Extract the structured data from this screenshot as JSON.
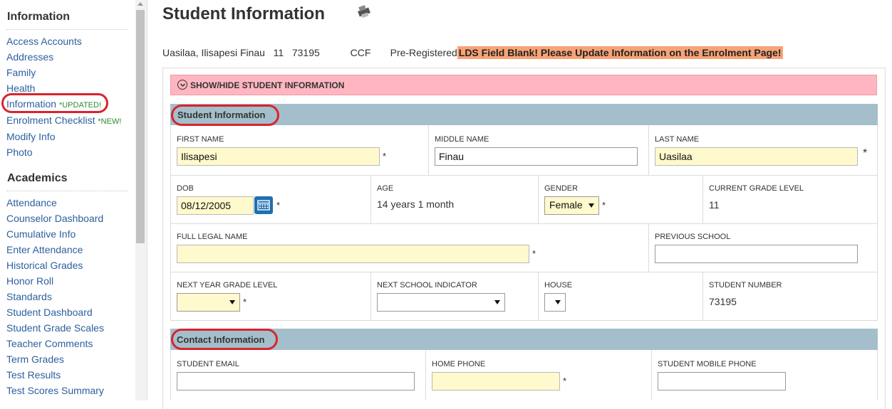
{
  "sidebar": {
    "information_heading": "Information",
    "information_items": [
      {
        "label": "Access Accounts"
      },
      {
        "label": "Addresses"
      },
      {
        "label": "Family"
      },
      {
        "label": "Health"
      },
      {
        "label": "Information",
        "tag": "*UPDATED!"
      },
      {
        "label": "Enrolment Checklist",
        "tag": "*NEW!"
      },
      {
        "label": "Modify Info"
      },
      {
        "label": "Photo"
      }
    ],
    "academics_heading": "Academics",
    "academics_items": [
      {
        "label": "Attendance"
      },
      {
        "label": "Counselor Dashboard"
      },
      {
        "label": "Cumulative Info"
      },
      {
        "label": "Enter Attendance"
      },
      {
        "label": "Historical Grades"
      },
      {
        "label": "Honor Roll"
      },
      {
        "label": "Standards"
      },
      {
        "label": "Student Dashboard"
      },
      {
        "label": "Student Grade Scales"
      },
      {
        "label": "Teacher Comments"
      },
      {
        "label": "Term Grades"
      },
      {
        "label": "Test Results"
      },
      {
        "label": "Test Scores Summary"
      }
    ]
  },
  "main": {
    "title": "Student Information",
    "print_icon": "print-icon",
    "summary": {
      "name": "Uasilaa, Ilisapesi Finau",
      "grade": "11",
      "student_number": "73195",
      "school": "CCF",
      "status": "Pre-Registered",
      "warning": "LDS Field Blank! Please Update Information on the Enrolment Page!"
    },
    "toggle_label": "SHOW/HIDE STUDENT INFORMATION",
    "student_section": {
      "title": "Student Information",
      "first_name_label": "FIRST NAME",
      "first_name_value": "Ilisapesi",
      "middle_name_label": "MIDDLE NAME",
      "middle_name_value": "Finau",
      "last_name_label": "LAST NAME",
      "last_name_value": "Uasilaa",
      "dob_label": "DOB",
      "dob_value": "08/12/2005",
      "age_label": "AGE",
      "age_value": "14 years 1 month",
      "gender_label": "GENDER",
      "gender_value": "Female",
      "grade_level_label": "CURRENT GRADE LEVEL",
      "grade_level_value": "11",
      "legal_name_label": "FULL LEGAL NAME",
      "legal_name_value": "",
      "previous_school_label": "PREVIOUS SCHOOL",
      "previous_school_value": "",
      "next_grade_label": "NEXT YEAR GRADE LEVEL",
      "next_school_label": "NEXT SCHOOL INDICATOR",
      "house_label": "HOUSE",
      "student_number_label": "STUDENT NUMBER",
      "student_number_value": "73195"
    },
    "contact_section": {
      "title": "Contact Information",
      "email_label": "STUDENT EMAIL",
      "email_value": "",
      "home_phone_label": "HOME PHONE",
      "home_phone_value": "",
      "mobile_label": "STUDENT MOBILE PHONE",
      "mobile_value": ""
    },
    "required_marker": "*"
  },
  "colors": {
    "link": "#2c5f9e",
    "highlight_circle": "#d9232d",
    "toggle_bar": "#ffb6c1",
    "section_bar": "#a4bfcb",
    "required_field": "#fffacd",
    "warning_banner": "#f7a376",
    "calendar_button": "#1f6fb0"
  }
}
